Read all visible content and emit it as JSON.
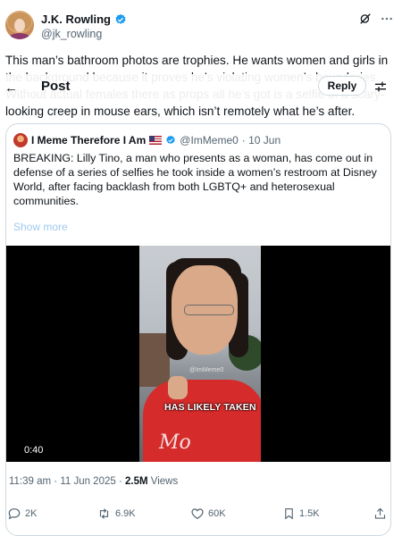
{
  "author": {
    "name": "J.K. Rowling",
    "handle": "@jk_rowling"
  },
  "tweet": {
    "text": "This man’s bathroom photos are trophies. He wants women and girls in the background because it proves he’s violating women’s boundaries. Without actual females there as props all he’s got is a selfie of a scary-looking creep in mouse ears, which isn’t remotely what he’s after."
  },
  "quote": {
    "name": "I Meme Therefore I Am",
    "handle": "@ImMeme0",
    "date": "· 10 Jun",
    "text": "BREAKING: Lilly Tino, a man who presents as a woman, has come out in defense of a series of selfies he took inside a women’s restroom at Disney World, after facing backlash from both LGBTQ+ and heterosexual communities.",
    "show_more": "Show more"
  },
  "video_header": {
    "title": "Post",
    "reply_label": "Reply"
  },
  "video": {
    "watermark": "@ImMeme0",
    "caption": "HAS LIKELY TAKEN",
    "duration": "0:40"
  },
  "meta": {
    "time": "11:39 am · 11 Jun 2025 · ",
    "views_count": "2.5M",
    "views_label": " Views"
  },
  "actions": {
    "replies": "2K",
    "reposts": "6.9K",
    "likes": "60K",
    "bookmarks": "1.5K"
  },
  "colors": {
    "verified": "#1d9bf0",
    "text": "#0f1419",
    "muted": "#536471",
    "border": "#cfd9de"
  }
}
